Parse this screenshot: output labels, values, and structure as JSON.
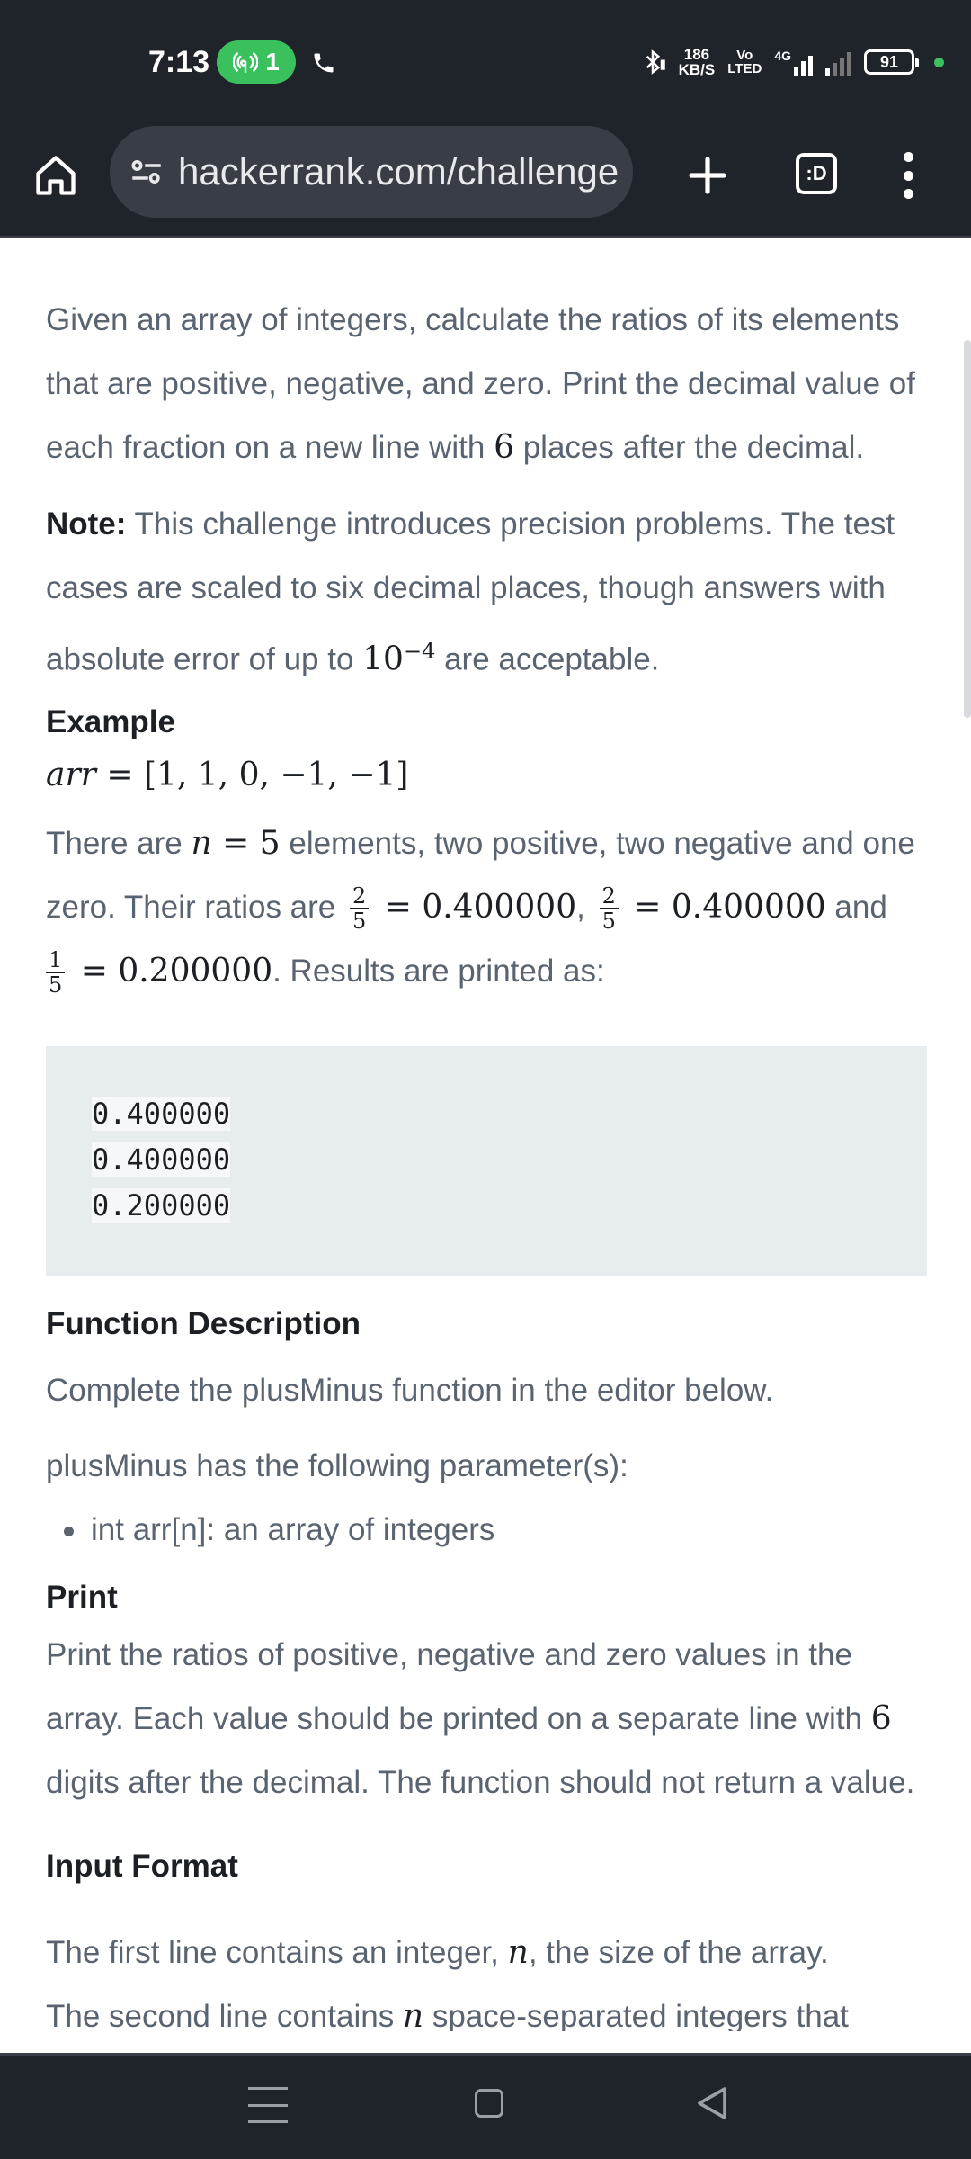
{
  "status_bar": {
    "time": "7:13",
    "hotspot_count": "1",
    "speed_value": "186",
    "speed_unit": "KB/S",
    "volte_top": "Vo",
    "volte_bottom": "LTED",
    "network": "4G",
    "battery": "91"
  },
  "browser": {
    "url": "hackerrank.com/challenge",
    "tabs_label": ":D"
  },
  "content": {
    "intro_1": "Given an array of integers, calculate the ratios of its elements that are positive, negative, and zero. Print the decimal value of each fraction on a new line with ",
    "intro_num": "6",
    "intro_2": " places after the decimal.",
    "note_label": "Note:",
    "note_1": " This challenge introduces precision problems. The test cases are scaled to six decimal places, though answers with absolute error of up to ",
    "note_base": "10",
    "note_exp": "−4",
    "note_2": " are acceptable.",
    "example_heading": "Example",
    "example_arr_name": "arr",
    "example_arr_value": " = [1, 1, 0, −1, −1]",
    "ex_p1": "There are ",
    "ex_n": "n",
    "ex_n_eq": " = 5",
    "ex_p2": " elements, two positive, two negative and one zero. Their ratios are ",
    "frac_num_a": "2",
    "frac_den_a": "5",
    "frac_val_a": " = 0.400000",
    "comma": ", ",
    "frac_num_b": "2",
    "frac_den_b": "5",
    "frac_val_b": " = 0.400000",
    "and": " and",
    "frac_num_c": "1",
    "frac_den_c": "5",
    "frac_val_c": " = 0.200000",
    "ex_p3": ". Results are printed as:",
    "code_lines": [
      "0.400000",
      "0.400000",
      "0.200000"
    ],
    "function_heading": "Function Description",
    "function_p1": "Complete the plusMinus function in the editor below.",
    "function_p2": "plusMinus has the following parameter(s):",
    "param_1": "int arr[n]: an array of integers",
    "print_heading": "Print",
    "print_1": "Print the ratios of positive, negative and zero values in the array. Each value should be printed on a separate line with ",
    "print_num": "6",
    "print_2": " digits after the decimal. The function should not return a value.",
    "input_heading": "Input Format",
    "input_1a": "The first line contains an integer, ",
    "input_1n": "n",
    "input_1b": ", the size of the array.",
    "input_2a": "The second line contains ",
    "input_2n": "n",
    "input_2b": " space-separated integers that"
  },
  "icons": {
    "home": "home-icon",
    "site_info": "tune-icon",
    "new_tab": "plus-icon",
    "menu": "more-vert-icon",
    "nav_recents": "menu-icon",
    "nav_home": "square-icon",
    "nav_back": "back-triangle-icon"
  },
  "colors": {
    "bar_bg": "#1f232a",
    "url_bg": "#383d46",
    "accent_green": "#3ac05c",
    "body_text": "#5a6470",
    "heading_text": "#1c1f24",
    "code_bg": "#e7edef"
  }
}
